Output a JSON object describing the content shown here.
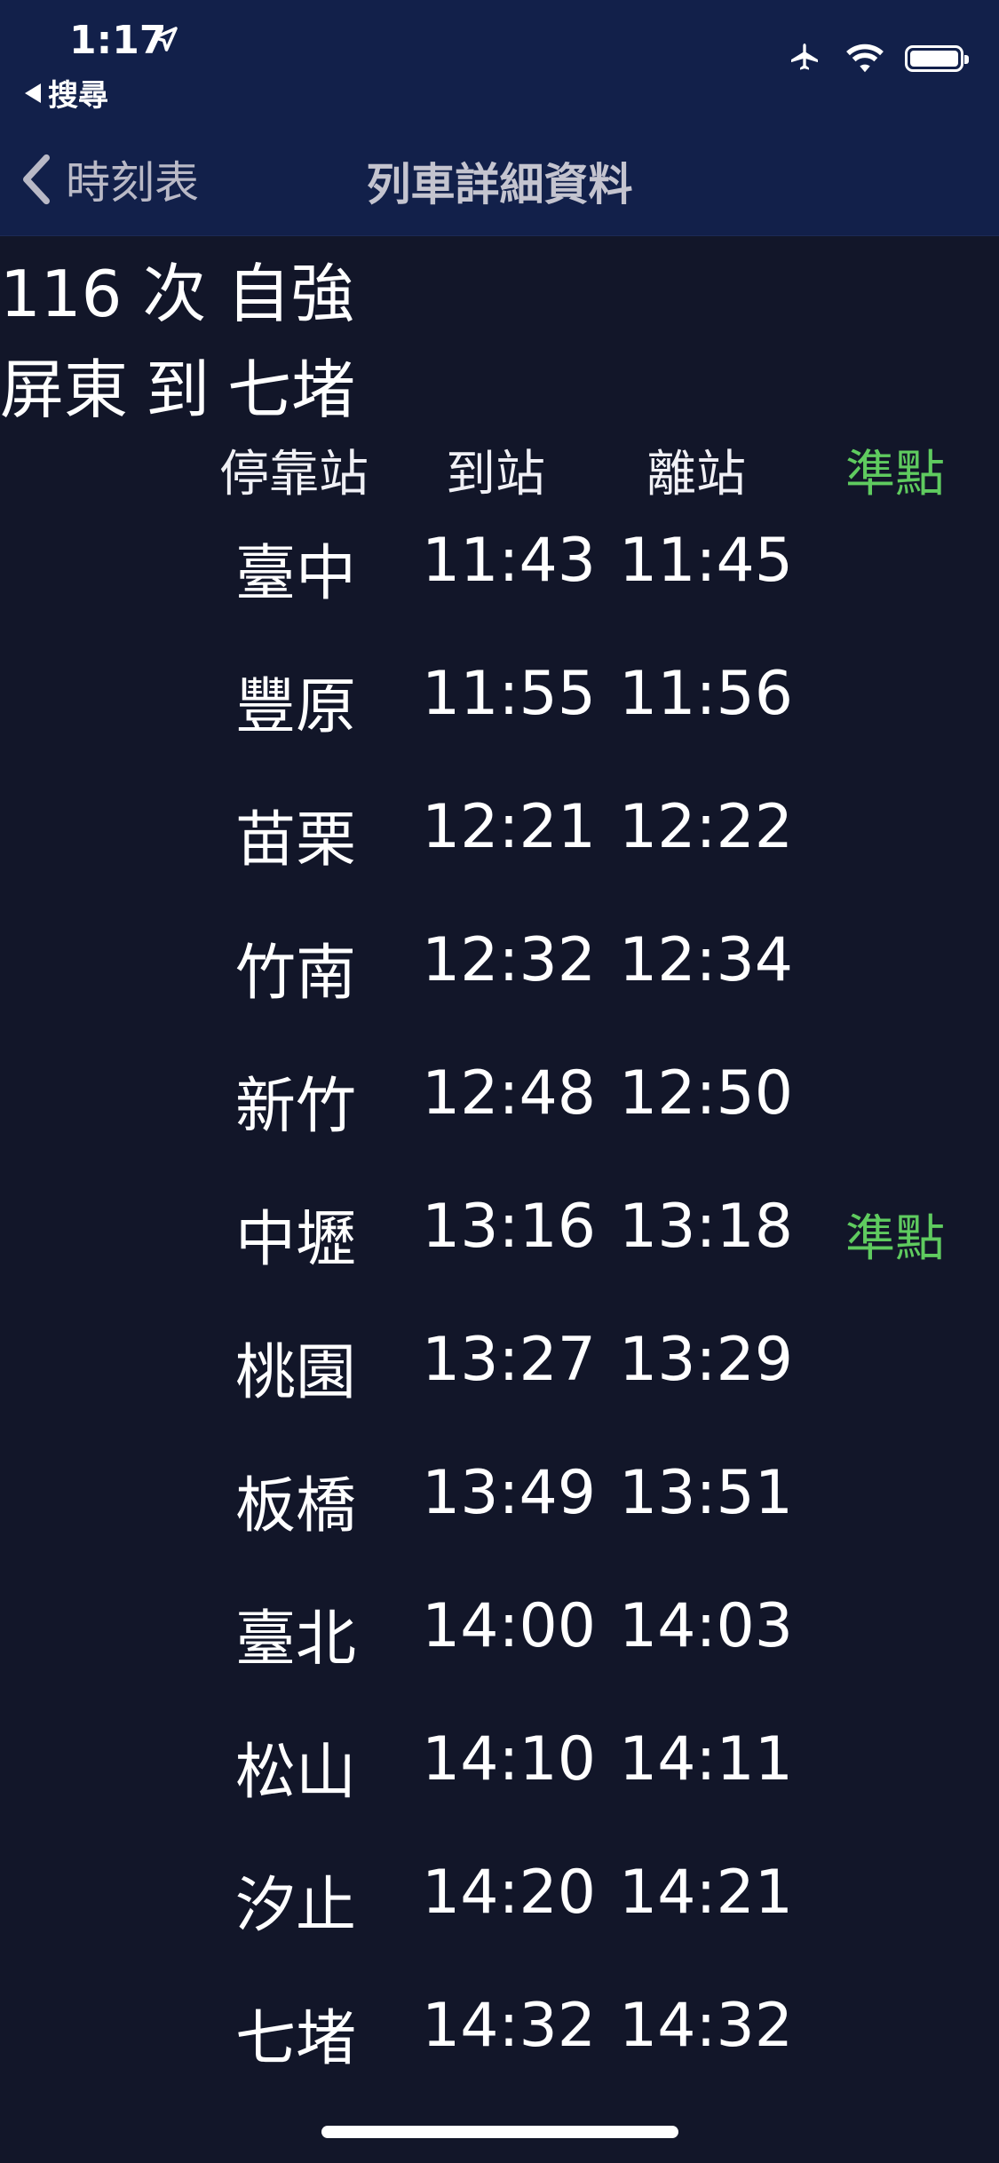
{
  "status_bar": {
    "time": "1:17",
    "back_app_label": "搜尋"
  },
  "navbar": {
    "back_label": "時刻表",
    "title": "列車詳細資料"
  },
  "train": {
    "title": "116 次 自強",
    "from": "屏東",
    "to_word": "到",
    "to": "七堵"
  },
  "table": {
    "headers": {
      "station": "停靠站",
      "arrival": "到站",
      "departure": "離站",
      "status": "準點"
    },
    "rows": [
      {
        "station": "臺中",
        "arrival": "11:43",
        "departure": "11:45",
        "status": ""
      },
      {
        "station": "豐原",
        "arrival": "11:55",
        "departure": "11:56",
        "status": ""
      },
      {
        "station": "苗栗",
        "arrival": "12:21",
        "departure": "12:22",
        "status": ""
      },
      {
        "station": "竹南",
        "arrival": "12:32",
        "departure": "12:34",
        "status": ""
      },
      {
        "station": "新竹",
        "arrival": "12:48",
        "departure": "12:50",
        "status": ""
      },
      {
        "station": "中壢",
        "arrival": "13:16",
        "departure": "13:18",
        "status": "準點"
      },
      {
        "station": "桃園",
        "arrival": "13:27",
        "departure": "13:29",
        "status": ""
      },
      {
        "station": "板橋",
        "arrival": "13:49",
        "departure": "13:51",
        "status": ""
      },
      {
        "station": "臺北",
        "arrival": "14:00",
        "departure": "14:03",
        "status": ""
      },
      {
        "station": "松山",
        "arrival": "14:10",
        "departure": "14:11",
        "status": ""
      },
      {
        "station": "汐止",
        "arrival": "14:20",
        "departure": "14:21",
        "status": ""
      },
      {
        "station": "七堵",
        "arrival": "14:32",
        "departure": "14:32",
        "status": ""
      }
    ]
  },
  "colors": {
    "background": "#121629",
    "topbar": "#12204a",
    "on_time_green": "#5fcb5f"
  }
}
